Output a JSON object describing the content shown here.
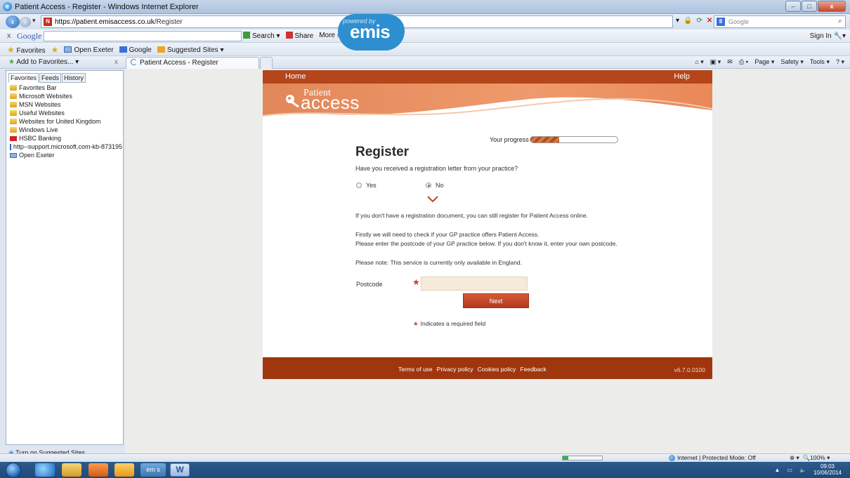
{
  "window": {
    "title": "Patient Access - Register - Windows Internet Explorer",
    "controls": {
      "minimize": "–",
      "maximize": "□",
      "close": "x"
    }
  },
  "address": {
    "url_host": "https://patient.emisaccess.co.uk",
    "url_path": "/Register",
    "search_placeholder": "Google"
  },
  "google_toolbar": {
    "close": "x",
    "logo": "Google",
    "search": "Search",
    "share": "Share",
    "more": "More »",
    "sign_in": "Sign In"
  },
  "favorites_bar": {
    "label": "Favorites",
    "items": [
      "Open Exeter",
      "Google",
      "Suggested Sites"
    ]
  },
  "tabs": {
    "add_to_favorites": "Add to Favorites...",
    "close_pane": "x",
    "active_tab": "Patient Access - Register"
  },
  "command_bar": [
    "Page",
    "Safety",
    "Tools"
  ],
  "favorites_pane": {
    "tabs": [
      "Favorites",
      "Feeds",
      "History"
    ],
    "items": [
      {
        "label": "Favorites Bar",
        "icon": "folder"
      },
      {
        "label": "Microsoft Websites",
        "icon": "folder"
      },
      {
        "label": "MSN Websites",
        "icon": "folder"
      },
      {
        "label": "Useful Websites",
        "icon": "folder"
      },
      {
        "label": "Websites for United Kingdom",
        "icon": "folder"
      },
      {
        "label": "Windows Live",
        "icon": "folder"
      },
      {
        "label": "HSBC Banking",
        "icon": "hsbc"
      },
      {
        "label": "http--support.microsoft.com-kb-873195",
        "icon": "microsoft"
      },
      {
        "label": "Open Exeter",
        "icon": "keyboard"
      }
    ],
    "suggested": "Turn on Suggested Sites..."
  },
  "page": {
    "nav": {
      "home": "Home",
      "help": "Help"
    },
    "logo": {
      "patient": "Patient",
      "access": "access",
      "powered_by": "powered by",
      "emis": "emis"
    },
    "progress": {
      "label": "Your progress",
      "fraction": 0.33
    },
    "title": "Register",
    "question": "Have you received a registration letter from your practice?",
    "options": {
      "yes": "Yes",
      "no": "No",
      "selected": "No"
    },
    "paragraphs": [
      "If you don't have a registration document, you can still register for Patient Access online.",
      "Firstly we will need to check if your GP practice offers Patient Access.",
      "Please enter the postcode of your GP practice below. If you don't know it, enter your own postcode.",
      "Please note: This service is currently only available in England."
    ],
    "postcode_label": "Postcode",
    "postcode_value": "",
    "next_button": "Next",
    "required_note": "Indicates a required field",
    "footer_links": [
      "Terms of use",
      "Privacy policy",
      "Cookies policy",
      "Feedback"
    ],
    "version": "v6.7.0.0100"
  },
  "status_bar": {
    "zone": "Internet | Protected Mode: Off",
    "zoom": "100%",
    "progress_fraction": 0.14
  },
  "taskbar": {
    "emis_label": "em s",
    "word_label": "W",
    "time": "09:03",
    "date": "10/06/2014"
  },
  "colors": {
    "brand_orange": "#b5451a",
    "footer": "#a0360e",
    "emis_blue": "#2e8fd0",
    "input_bg": "#f6ead8"
  }
}
